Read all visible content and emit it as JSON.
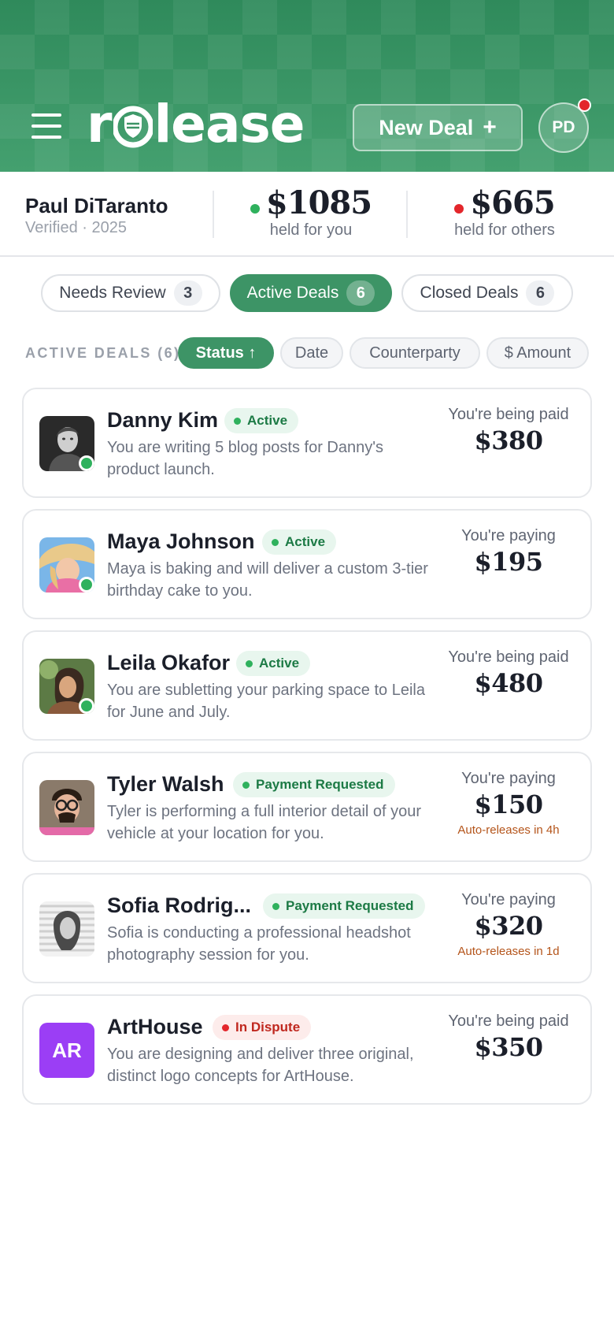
{
  "header": {
    "logo_text_left": "r",
    "logo_text_right": "lease",
    "new_deal_label": "New Deal",
    "new_deal_icon": "+",
    "avatar_initials": "PD",
    "brand_color": "#3d9466"
  },
  "summary": {
    "user_name": "Paul DiTaranto",
    "user_sub": "Verified · 2025",
    "held_for_you": {
      "amount": "$1085",
      "label": "held for you",
      "dot_color": "#2fb15d"
    },
    "held_for_others": {
      "amount": "$665",
      "label": "held for others",
      "dot_color": "#e3262b"
    }
  },
  "tabs": [
    {
      "label": "Needs Review",
      "count": "3",
      "active": false
    },
    {
      "label": "Active Deals",
      "count": "6",
      "active": true
    },
    {
      "label": "Closed Deals",
      "count": "6",
      "active": false
    }
  ],
  "sort": {
    "label": "ACTIVE DEALS (6)",
    "options": [
      {
        "label": "Status ↑",
        "active": true
      },
      {
        "label": "Date",
        "active": false
      },
      {
        "label": "Counterparty",
        "active": false
      },
      {
        "label": "$ Amount",
        "active": false
      }
    ]
  },
  "deals": [
    {
      "name": "Danny Kim",
      "status": "Active",
      "status_color": "green",
      "description": "You are writing 5 blog posts for Danny's product launch.",
      "direction": "You're being paid",
      "amount": "$380",
      "auto_release": "",
      "online": true
    },
    {
      "name": "Maya Johnson",
      "status": "Active",
      "status_color": "green",
      "description": "Maya is baking and will deliver a custom 3-tier birthday cake to you.",
      "direction": "You're paying",
      "amount": "$195",
      "auto_release": "",
      "online": true
    },
    {
      "name": "Leila Okafor",
      "status": "Active",
      "status_color": "green",
      "description": "You are subletting your parking space to Leila for June and July.",
      "direction": "You're being paid",
      "amount": "$480",
      "auto_release": "",
      "online": true
    },
    {
      "name": "Tyler Walsh",
      "status": "Payment Requested",
      "status_color": "green",
      "description": "Tyler is performing a full interior detail of your vehicle at your location for you.",
      "direction": "You're paying",
      "amount": "$150",
      "auto_release": "Auto-releases in 4h",
      "online": false
    },
    {
      "name": "Sofia Rodrig...",
      "status": "Payment Requested",
      "status_color": "green",
      "description": "Sofia is conducting a professional headshot photography session for you.",
      "direction": "You're paying",
      "amount": "$320",
      "auto_release": "Auto-releases in 1d",
      "online": false
    },
    {
      "name": "ArtHouse",
      "status": "In Dispute",
      "status_color": "red",
      "description": "You are designing and deliver three original, distinct logo concepts for ArtHouse.",
      "direction": "You're being paid",
      "amount": "$350",
      "auto_release": "",
      "online": false,
      "initials": "AR"
    }
  ]
}
